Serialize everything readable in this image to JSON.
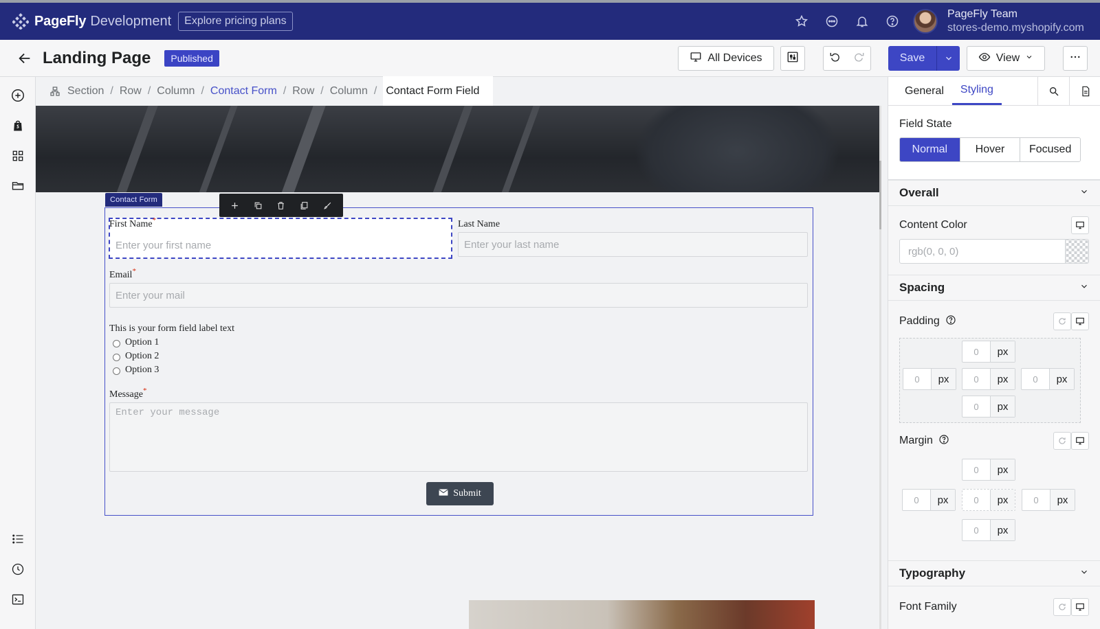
{
  "topbar": {
    "brand_name": "PageFly",
    "brand_env": "Development",
    "pricing_label": "Explore pricing plans",
    "account_name": "PageFly Team",
    "account_store": "stores-demo.myshopify.com"
  },
  "header": {
    "page_title": "Landing Page",
    "status_badge": "Published",
    "devices_label": "All Devices",
    "save_label": "Save",
    "view_label": "View"
  },
  "breadcrumb": {
    "items": [
      "Section",
      "Row",
      "Column",
      "Contact Form",
      "Row",
      "Column"
    ],
    "current": "Contact Form Field"
  },
  "canvas": {
    "element_label": "Contact Form",
    "form": {
      "first_name_label": "First Name",
      "first_name_placeholder": "Enter your first name",
      "last_name_label": "Last Name",
      "last_name_placeholder": "Enter your last name",
      "email_label": "Email",
      "email_placeholder": "Enter your mail",
      "radio_group_label": "This is your form field label text",
      "options": [
        "Option 1",
        "Option 2",
        "Option 3"
      ],
      "message_label": "Message",
      "message_placeholder": "Enter your message",
      "required_mark": "*",
      "submit_label": "Submit"
    }
  },
  "panel": {
    "tabs": [
      "General",
      "Styling"
    ],
    "active_tab": "Styling",
    "field_state_title": "Field State",
    "field_states": [
      "Normal",
      "Hover",
      "Focused"
    ],
    "active_state": "Normal",
    "overall_title": "Overall",
    "content_color_label": "Content Color",
    "content_color_placeholder": "rgb(0, 0, 0)",
    "spacing_title": "Spacing",
    "padding_label": "Padding",
    "margin_label": "Margin",
    "spacing_value": "0",
    "unit": "px",
    "typography_title": "Typography",
    "font_family_label": "Font Family"
  },
  "colors": {
    "topbar_bg": "#232b7c",
    "accent": "#3d46c4",
    "required": "#d72c0d"
  }
}
